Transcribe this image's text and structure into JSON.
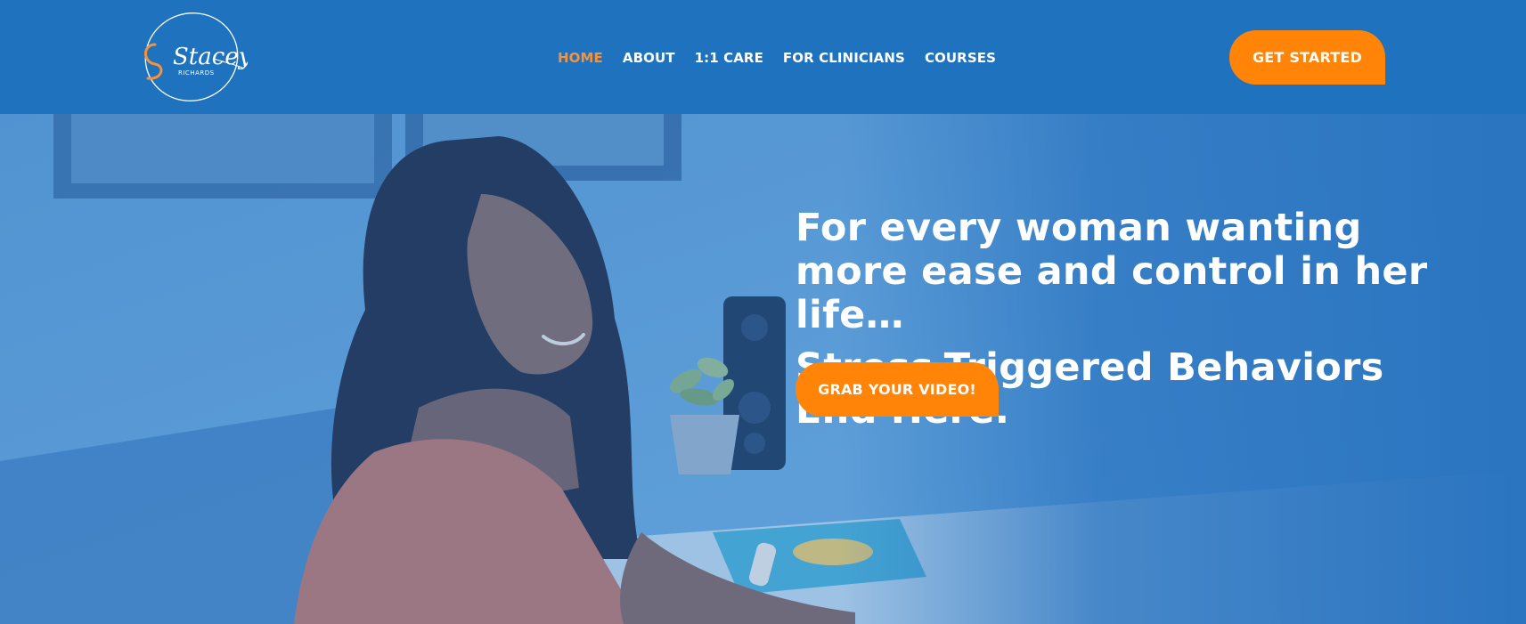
{
  "brand": {
    "logo_name": "Stacey Richards signature logo",
    "logo_text_script": "Stacey",
    "logo_text_small": "RICHARDS",
    "accent_color": "#ff8407",
    "header_color": "#1f72bd"
  },
  "nav": {
    "items": [
      {
        "label": "HOME",
        "active": true
      },
      {
        "label": "ABOUT",
        "active": false
      },
      {
        "label": "1:1 CARE",
        "active": false
      },
      {
        "label": "FOR CLINICIANS",
        "active": false
      },
      {
        "label": "COURSES",
        "active": false
      }
    ],
    "cta_label": "GET STARTED"
  },
  "hero": {
    "headline": "For every woman wanting more ease and control in her life…",
    "subheadline": "Stress-Triggered Behaviors End Here.",
    "cta_label": "GRAB YOUR VIDEO!",
    "image": "woman smiling while writing at desk"
  }
}
